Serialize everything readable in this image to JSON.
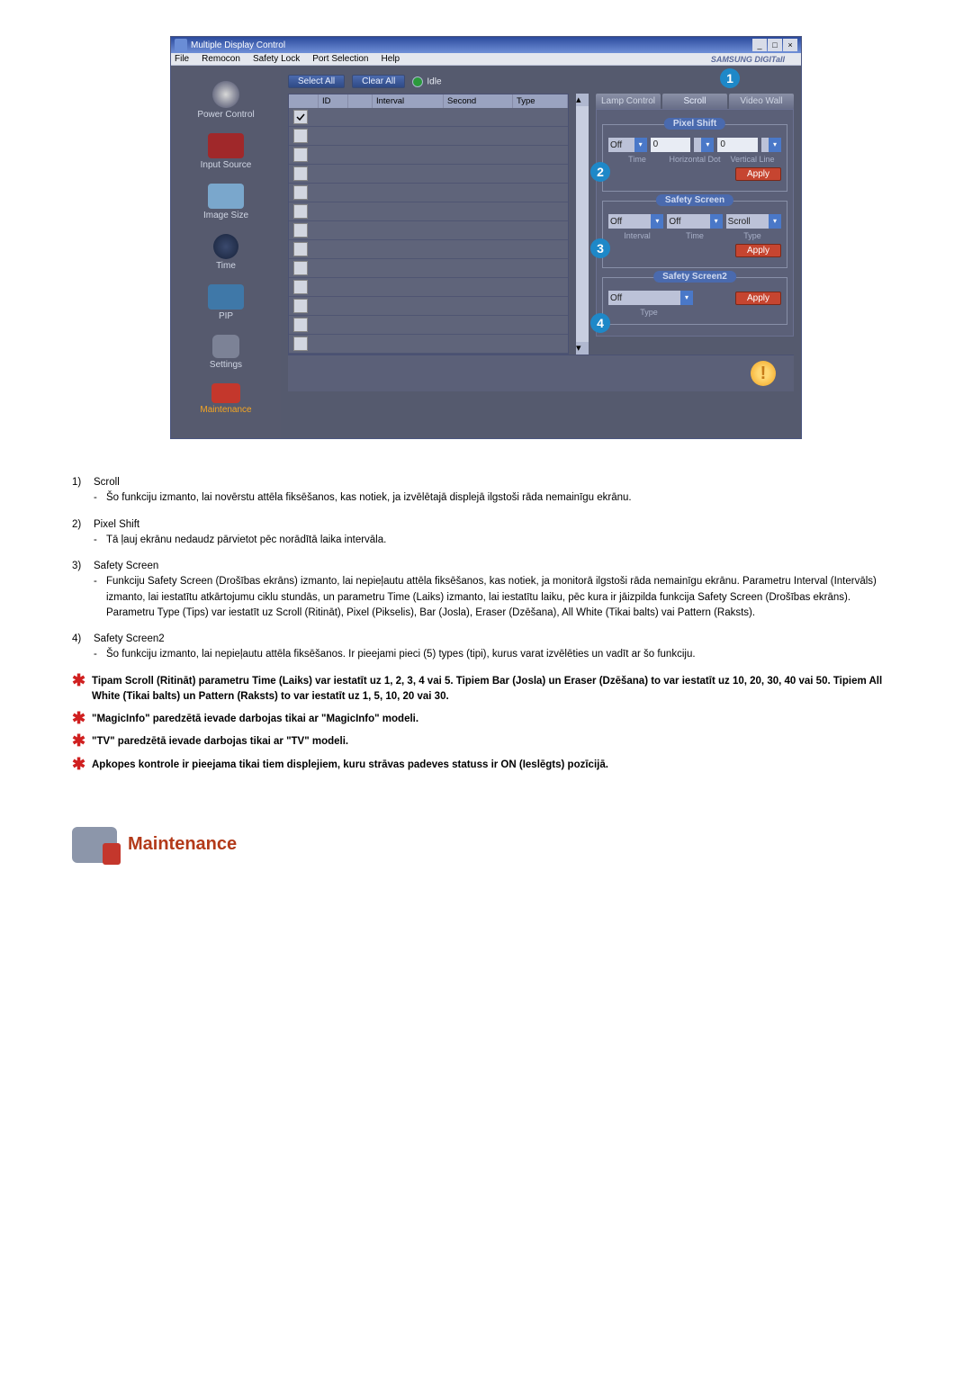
{
  "window": {
    "title": "Multiple Display Control"
  },
  "menubar": {
    "items": [
      "File",
      "Remocon",
      "Safety Lock",
      "Port Selection",
      "Help"
    ],
    "brand": "SAMSUNG DIGITall"
  },
  "sidebar": {
    "items": [
      {
        "label": "Power Control"
      },
      {
        "label": "Input Source"
      },
      {
        "label": "Image Size"
      },
      {
        "label": "Time"
      },
      {
        "label": "PIP"
      },
      {
        "label": "Settings"
      },
      {
        "label": "Maintenance"
      }
    ]
  },
  "toolbar": {
    "select_all": "Select All",
    "clear_all": "Clear All",
    "idle": "Idle"
  },
  "grid": {
    "headers": [
      "",
      "ID",
      "",
      "Interval",
      "Second",
      "Type"
    ]
  },
  "tabs": {
    "lamp": "Lamp Control",
    "scroll": "Scroll",
    "video": "Video Wall"
  },
  "callouts": {
    "c1": "1",
    "c2": "2",
    "c3": "3",
    "c4": "4"
  },
  "pixel_shift": {
    "legend": "Pixel Shift",
    "off": "Off",
    "hd_val": "0",
    "vl_val": "0",
    "lbl_time": "Time",
    "lbl_hd": "Horizontal Dot",
    "lbl_vl": "Vertical Line",
    "apply": "Apply"
  },
  "safety_screen": {
    "legend": "Safety Screen",
    "interval_val": "Off",
    "time_val": "Off",
    "type_val": "Scroll",
    "lbl_interval": "Interval",
    "lbl_time": "Time",
    "lbl_type": "Type",
    "apply": "Apply"
  },
  "safety_screen2": {
    "legend": "Safety Screen2",
    "type_val": "Off",
    "lbl_type": "Type",
    "apply": "Apply"
  },
  "notes": {
    "n1t": "Scroll",
    "n1d": "Šo funkciju izmanto, lai novērstu attēla fiksēšanos, kas notiek, ja izvēlētajā displejā ilgstoši rāda nemainīgu ekrānu.",
    "n2t": "Pixel Shift",
    "n2d": "Tā ļauj ekrānu nedaudz pārvietot pēc norādītā laika intervāla.",
    "n3t": "Safety Screen",
    "n3d1": "Funkciju Safety Screen (Drošības ekrāns) izmanto, lai nepieļautu attēla fiksēšanos, kas notiek, ja monitorā ilgstoši rāda nemainīgu ekrānu.  Parametru Interval (Intervāls) izmanto, lai iestatītu atkārtojumu ciklu stundās, un parametru Time (Laiks) izmanto, lai iestatītu laiku, pēc kura ir jāizpilda funkcija Safety Screen (Drošības ekrāns).",
    "n3d2": "Parametru Type (Tips) var iestatīt uz Scroll (Ritināt), Pixel (Pikselis), Bar (Josla), Eraser (Dzēšana), All White (Tikai balts) vai Pattern (Raksts).",
    "n4t": "Safety Screen2",
    "n4d": "Šo funkciju izmanto, lai nepieļautu attēla fiksēšanos. Ir pieejami pieci (5) types (tipi), kurus varat izvēlēties un vadīt ar šo funkciju.",
    "s1": "Tipam Scroll (Ritināt) parametru Time (Laiks) var iestatīt uz 1, 2, 3, 4 vai 5. Tipiem Bar (Josla) un Eraser (Dzēšana) to var iestatīt uz 10, 20, 30, 40 vai 50. Tipiem All White (Tikai balts) un Pattern (Raksts) to var iestatīt uz 1, 5, 10, 20 vai 30.",
    "s2": "\"MagicInfo\" paredzētā ievade darbojas tikai ar \"MagicInfo\" modeli.",
    "s3": "\"TV\" paredzētā ievade darbojas tikai ar \"TV\" modeli.",
    "s4": "Apkopes kontrole ir pieejama tikai tiem displejiem, kuru strāvas padeves statuss ir ON (Ieslēgts) pozīcijā."
  },
  "section_heading": "Maintenance"
}
